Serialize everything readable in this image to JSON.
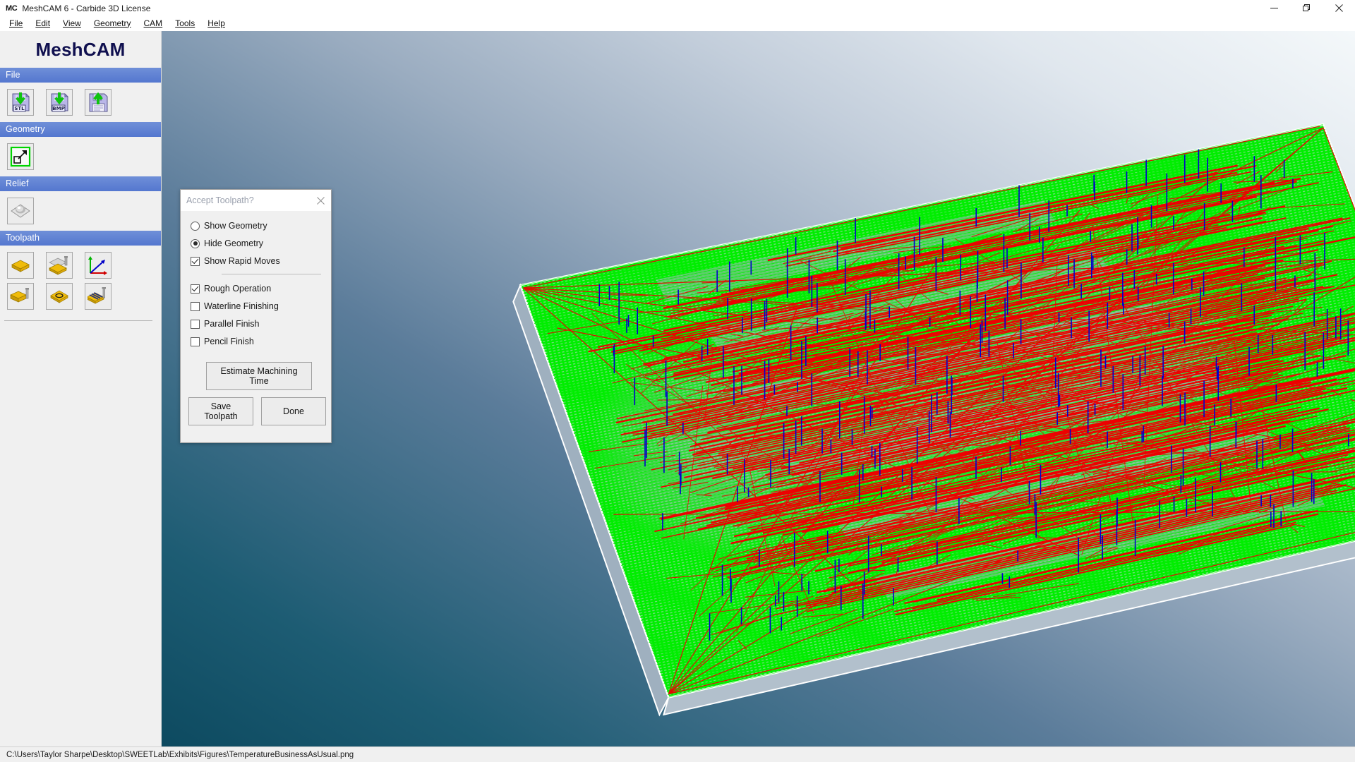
{
  "window": {
    "app_icon_text": "MC",
    "title": "MeshCAM 6 - Carbide 3D License",
    "controls": {
      "minimize": "minimize-button",
      "maximize": "maximize-button",
      "close": "close-button"
    }
  },
  "menubar": {
    "items": [
      {
        "label": "File"
      },
      {
        "label": "Edit"
      },
      {
        "label": "View"
      },
      {
        "label": "Geometry"
      },
      {
        "label": "CAM"
      },
      {
        "label": "Tools"
      },
      {
        "label": "Help"
      }
    ]
  },
  "sidebar": {
    "brand": "MeshCAM",
    "sections": [
      {
        "header": "File",
        "tools": [
          {
            "name": "open-stl-icon",
            "label": "STL"
          },
          {
            "name": "open-bmp-icon",
            "label": "BMP"
          },
          {
            "name": "save-file-icon",
            "label": ""
          }
        ]
      },
      {
        "header": "Geometry",
        "tools": [
          {
            "name": "resize-geometry-icon",
            "label": ""
          }
        ]
      },
      {
        "header": "Relief",
        "tools": [
          {
            "name": "create-relief-icon",
            "label": ""
          }
        ]
      },
      {
        "header": "Toolpath",
        "tools": [
          {
            "name": "define-stock-icon",
            "label": ""
          },
          {
            "name": "rough-toolpath-icon",
            "label": ""
          },
          {
            "name": "set-origin-icon",
            "label": ""
          },
          {
            "name": "waterline-toolpath-icon",
            "label": ""
          },
          {
            "name": "pencil-toolpath-icon",
            "label": ""
          },
          {
            "name": "parallel-toolpath-icon",
            "label": ""
          }
        ]
      }
    ]
  },
  "dialog": {
    "title": "Accept Toolpath?",
    "close_icon": "close-icon",
    "display_options": [
      {
        "type": "radio",
        "label": "Show Geometry",
        "checked": false
      },
      {
        "type": "radio",
        "label": "Hide Geometry",
        "checked": true
      },
      {
        "type": "checkbox",
        "label": "Show Rapid Moves",
        "checked": true
      }
    ],
    "operation_options": [
      {
        "type": "checkbox",
        "label": "Rough Operation",
        "checked": true
      },
      {
        "type": "checkbox",
        "label": "Waterline Finishing",
        "checked": false
      },
      {
        "type": "checkbox",
        "label": "Parallel Finish",
        "checked": false
      },
      {
        "type": "checkbox",
        "label": "Pencil Finish",
        "checked": false
      }
    ],
    "estimate_button": "Estimate Machining Time",
    "save_button": "Save Toolpath",
    "done_button": "Done"
  },
  "statusbar": {
    "path": "C:\\Users\\Taylor Sharpe\\Desktop\\SWEETLab\\Exhibits\\Figures\\TemperatureBusinessAsUsual.png"
  },
  "viewport": {
    "description": "3D toolpath preview of a rectangular stock block viewed in isometric perspective",
    "colors": {
      "model_surface": "#00ee00",
      "rapid_moves": "#ee0000",
      "plunge_moves": "#0000cc",
      "stock_outline": "#ffffff",
      "shadow": "#9aa7b4",
      "bg_top_right": "#f4f8fa",
      "bg_bottom_left": "#0d4a60"
    }
  }
}
